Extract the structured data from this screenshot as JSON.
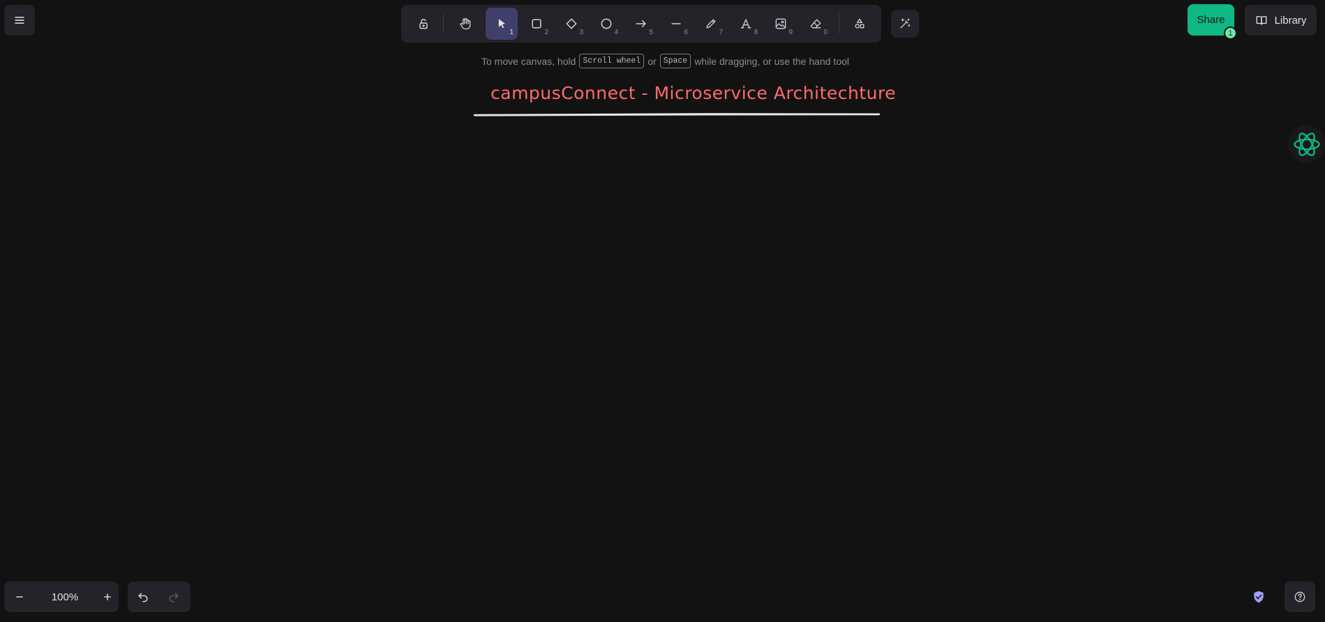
{
  "toolbar": {
    "tools": [
      {
        "name": "lock",
        "key": ""
      },
      {
        "name": "hand",
        "key": ""
      },
      {
        "name": "selection",
        "key": "1"
      },
      {
        "name": "rectangle",
        "key": "2"
      },
      {
        "name": "diamond",
        "key": "3"
      },
      {
        "name": "ellipse",
        "key": "4"
      },
      {
        "name": "arrow",
        "key": "5"
      },
      {
        "name": "line",
        "key": "6"
      },
      {
        "name": "draw",
        "key": "7"
      },
      {
        "name": "text",
        "key": "8"
      },
      {
        "name": "image",
        "key": "9"
      },
      {
        "name": "eraser",
        "key": "0"
      },
      {
        "name": "more-shapes",
        "key": ""
      }
    ],
    "active_tool": "selection"
  },
  "share": {
    "label": "Share",
    "badge": "1"
  },
  "library": {
    "label": "Library"
  },
  "hint": {
    "part1": "To move canvas, hold",
    "key1": "Scroll wheel",
    "part2": "or",
    "key2": "Space",
    "part3": "while dragging, or use the hand tool"
  },
  "canvas": {
    "title_text": "campusConnect - Microservice Architechture",
    "title_color": "#ff6b6b"
  },
  "footer": {
    "zoom": "100%"
  },
  "colors": {
    "background": "#121212",
    "panel": "#232329",
    "active_tool": "#403e6a",
    "share": "#0fb884",
    "shield": "#a3a0f5"
  }
}
